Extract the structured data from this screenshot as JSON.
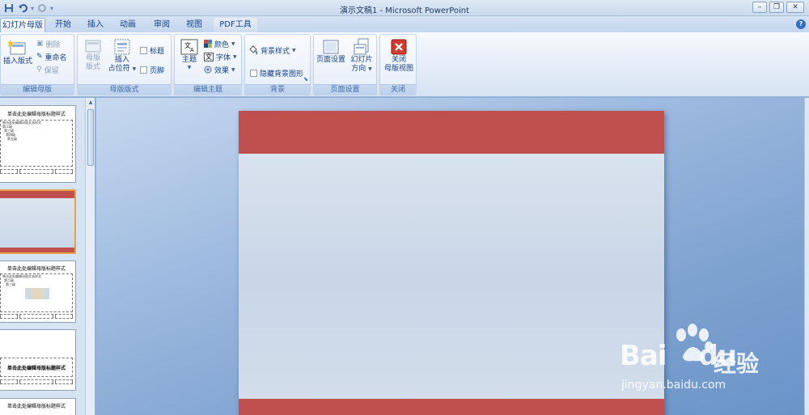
{
  "window": {
    "title": "演示文稿1 - Microsoft PowerPoint"
  },
  "tabs": [
    {
      "label": "幻灯片母版",
      "active": true
    },
    {
      "label": "开始"
    },
    {
      "label": "插入"
    },
    {
      "label": "动画"
    },
    {
      "label": "审阅"
    },
    {
      "label": "视图"
    },
    {
      "label": "PDF工具"
    }
  ],
  "ribbon": {
    "edit_master": {
      "label": "编辑母版",
      "insert_slide_master": "插入版式",
      "delete": "删除",
      "rename": "重命名",
      "preserve": "保留"
    },
    "master_layout": {
      "label": "母版版式",
      "master_layout_btn_1": "母版",
      "master_layout_btn_2": "版式",
      "insert_placeholder_1": "插入",
      "insert_placeholder_2": "占位符",
      "title": "标题",
      "footers": "页脚"
    },
    "edit_theme": {
      "label": "编辑主题",
      "themes": "主题",
      "colors": "颜色",
      "fonts": "字体",
      "effects": "效果"
    },
    "background": {
      "label": "背景",
      "background_styles": "背景样式",
      "hide_background": "隐藏背景图形"
    },
    "page_setup": {
      "label": "页面设置",
      "page_setup_btn": "页面设置",
      "orientation_1": "幻灯片",
      "orientation_2": "方向"
    },
    "close": {
      "label": "关闭",
      "close_1": "关闭",
      "close_2": "母版视图"
    }
  },
  "thumbnails": [
    {
      "title": "单击此处编辑母版标题样式",
      "lines": [
        "单击此处编辑母版文本样式",
        "第二级",
        "第三级",
        "第四级",
        "第五级"
      ]
    },
    {
      "title": "",
      "lines": []
    },
    {
      "title": "单击此处编辑母版标题样式",
      "lines": [
        "单击此处编辑母版文本样式",
        "第二级",
        "第三级"
      ]
    },
    {
      "title": "单击此处编辑母版标题样式",
      "lines": []
    },
    {
      "title": "单击此处编辑母版标题样式",
      "lines": []
    }
  ],
  "watermark": {
    "brand": "Bai",
    "brand_suffix": "du",
    "cn": "经验",
    "url": "jingyan.baidu.com"
  },
  "colors": {
    "accent_red": "#c0504d",
    "ribbon_text": "#15428b"
  }
}
